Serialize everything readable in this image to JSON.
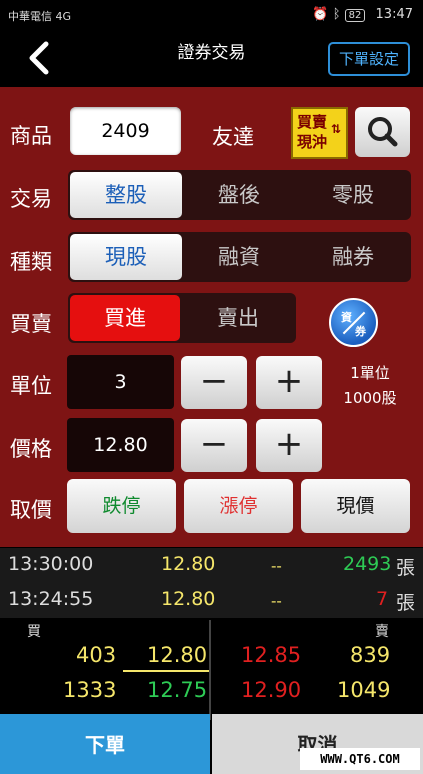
{
  "status": {
    "carrier": "中華電信 4G",
    "battery": "82",
    "time": "13:47"
  },
  "header": {
    "title": "證券交易",
    "order_setting": "下單設定"
  },
  "product": {
    "label": "商品",
    "code": "2409",
    "name": "友達",
    "daytrade_line1": "買賣",
    "daytrade_line2": "現沖"
  },
  "trade": {
    "label": "交易",
    "options": [
      "整股",
      "盤後",
      "零股"
    ],
    "selected": "整股"
  },
  "type": {
    "label": "種類",
    "options": [
      "現股",
      "融資",
      "融券"
    ],
    "selected": "現股"
  },
  "side": {
    "label": "買賣",
    "buy": "買進",
    "sell": "賣出",
    "selected": "買進",
    "cash_secu_a": "資",
    "cash_secu_b": "券"
  },
  "unit": {
    "label": "單位",
    "value": "3",
    "info_line1": "1單位",
    "info_line2": "1000股"
  },
  "price": {
    "label": "價格",
    "value": "12.80"
  },
  "price_btns": {
    "label": "取價",
    "limit_down": "跌停",
    "limit_up": "漲停",
    "current": "現價"
  },
  "steppers": {
    "minus": "−",
    "plus": "+"
  },
  "colors": {
    "panel": "#7e1414",
    "up": "#e02020",
    "down": "#2ecb55",
    "neutral": "#f5e66b"
  },
  "ticks": [
    {
      "time": "13:30:00",
      "price": "12.80",
      "change": "--",
      "volume": "2493",
      "unit": "張",
      "vol_color": "#2ecb55"
    },
    {
      "time": "13:24:55",
      "price": "12.80",
      "change": "--",
      "volume": "7",
      "unit": "張",
      "vol_color": "#e02020"
    }
  ],
  "book": {
    "bid_label": "買",
    "ask_label": "賣",
    "rows": [
      {
        "bid_qty": "403",
        "bid_price": "12.80",
        "ask_price": "12.85",
        "ask_qty": "839"
      },
      {
        "bid_qty": "1333",
        "bid_price": "12.75",
        "ask_price": "12.90",
        "ask_qty": "1049"
      }
    ]
  },
  "footer": {
    "order": "下單",
    "cancel": "取消",
    "watermark": "WWW.QT6.COM"
  }
}
